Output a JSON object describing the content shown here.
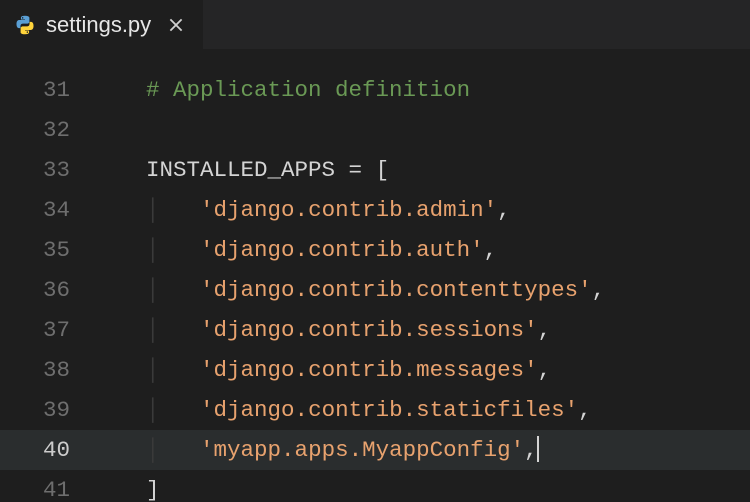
{
  "tab": {
    "filename": "settings.py",
    "icon": "python-icon"
  },
  "colors": {
    "python_blue": "#5a9fd4",
    "python_yellow": "#ffd43b"
  },
  "editor": {
    "active_line_index": 9,
    "lines": [
      {
        "num": 31,
        "segments": [
          {
            "cls": "indent",
            "txt": "    "
          },
          {
            "cls": "tok-comment",
            "txt": "# Application definition"
          }
        ]
      },
      {
        "num": 32,
        "segments": []
      },
      {
        "num": 33,
        "segments": [
          {
            "cls": "indent",
            "txt": "    "
          },
          {
            "cls": "tok-var",
            "txt": "INSTALLED_APPS"
          },
          {
            "cls": "tok-op",
            "txt": " = "
          },
          {
            "cls": "tok-bracket",
            "txt": "["
          }
        ]
      },
      {
        "num": 34,
        "segments": [
          {
            "cls": "indent",
            "txt": "    "
          },
          {
            "cls": "indent-guide",
            "txt": "│"
          },
          {
            "cls": "indent",
            "txt": "   "
          },
          {
            "cls": "tok-string",
            "txt": "'django.contrib.admin'"
          },
          {
            "cls": "tok-punc",
            "txt": ","
          }
        ]
      },
      {
        "num": 35,
        "segments": [
          {
            "cls": "indent",
            "txt": "    "
          },
          {
            "cls": "indent-guide",
            "txt": "│"
          },
          {
            "cls": "indent",
            "txt": "   "
          },
          {
            "cls": "tok-string",
            "txt": "'django.contrib.auth'"
          },
          {
            "cls": "tok-punc",
            "txt": ","
          }
        ]
      },
      {
        "num": 36,
        "segments": [
          {
            "cls": "indent",
            "txt": "    "
          },
          {
            "cls": "indent-guide",
            "txt": "│"
          },
          {
            "cls": "indent",
            "txt": "   "
          },
          {
            "cls": "tok-string",
            "txt": "'django.contrib.contenttypes'"
          },
          {
            "cls": "tok-punc",
            "txt": ","
          }
        ]
      },
      {
        "num": 37,
        "segments": [
          {
            "cls": "indent",
            "txt": "    "
          },
          {
            "cls": "indent-guide",
            "txt": "│"
          },
          {
            "cls": "indent",
            "txt": "   "
          },
          {
            "cls": "tok-string",
            "txt": "'django.contrib.sessions'"
          },
          {
            "cls": "tok-punc",
            "txt": ","
          }
        ]
      },
      {
        "num": 38,
        "segments": [
          {
            "cls": "indent",
            "txt": "    "
          },
          {
            "cls": "indent-guide",
            "txt": "│"
          },
          {
            "cls": "indent",
            "txt": "   "
          },
          {
            "cls": "tok-string",
            "txt": "'django.contrib.messages'"
          },
          {
            "cls": "tok-punc",
            "txt": ","
          }
        ]
      },
      {
        "num": 39,
        "segments": [
          {
            "cls": "indent",
            "txt": "    "
          },
          {
            "cls": "indent-guide",
            "txt": "│"
          },
          {
            "cls": "indent",
            "txt": "   "
          },
          {
            "cls": "tok-string",
            "txt": "'django.contrib.staticfiles'"
          },
          {
            "cls": "tok-punc",
            "txt": ","
          }
        ]
      },
      {
        "num": 40,
        "segments": [
          {
            "cls": "indent",
            "txt": "    "
          },
          {
            "cls": "indent-guide",
            "txt": "│"
          },
          {
            "cls": "indent",
            "txt": "   "
          },
          {
            "cls": "tok-string",
            "txt": "'myapp.apps.MyappConfig'"
          },
          {
            "cls": "tok-punc",
            "txt": ","
          }
        ],
        "cursor_after": true
      },
      {
        "num": 41,
        "segments": [
          {
            "cls": "indent",
            "txt": "    "
          },
          {
            "cls": "tok-bracket",
            "txt": "]"
          }
        ]
      }
    ]
  }
}
